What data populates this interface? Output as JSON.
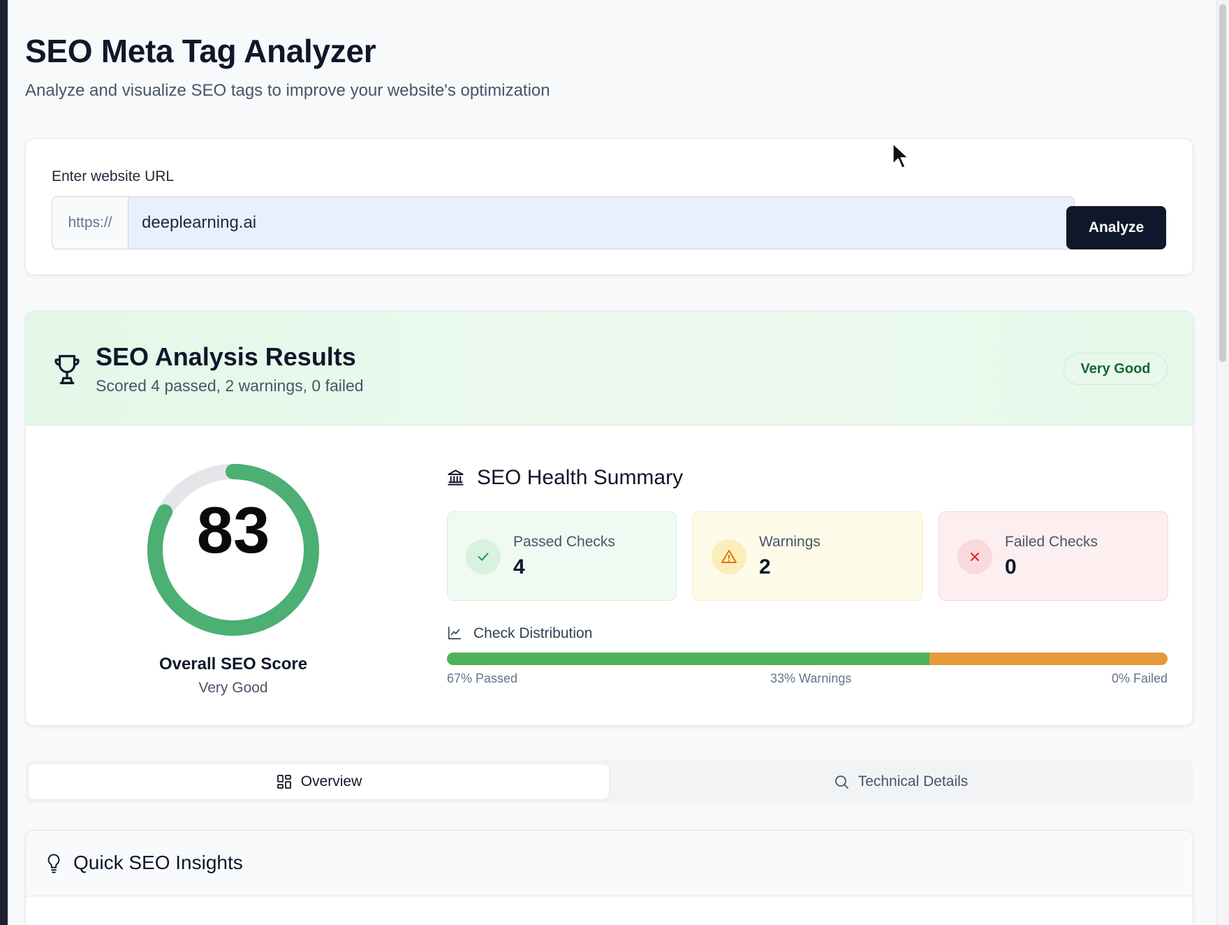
{
  "header": {
    "title": "SEO Meta Tag Analyzer",
    "subtitle": "Analyze and visualize SEO tags to improve your website's optimization"
  },
  "url_form": {
    "label": "Enter website URL",
    "prefix": "https://",
    "value": "deeplearning.ai",
    "button_label": "Analyze"
  },
  "results": {
    "title": "SEO Analysis Results",
    "subtitle": "Scored 4 passed, 2 warnings, 0 failed",
    "badge": "Very Good",
    "score": {
      "value": "83",
      "percent": 83,
      "label": "Overall SEO Score",
      "rating": "Very Good"
    },
    "health_summary": {
      "title": "SEO Health Summary",
      "passed": {
        "label": "Passed Checks",
        "value": "4"
      },
      "warnings": {
        "label": "Warnings",
        "value": "2"
      },
      "failed": {
        "label": "Failed Checks",
        "value": "0"
      }
    },
    "distribution": {
      "title": "Check Distribution",
      "passed_pct": 67,
      "warnings_pct": 33,
      "failed_pct": 0,
      "passed_label": "67% Passed",
      "warnings_label": "33% Warnings",
      "failed_label": "0% Failed"
    }
  },
  "tabs": [
    {
      "label": "Overview",
      "icon": "grid-icon",
      "active": true
    },
    {
      "label": "Technical Details",
      "icon": "search-icon",
      "active": false
    }
  ],
  "insights": {
    "title": "Quick SEO Insights"
  },
  "colors": {
    "passed": "#4fb25a",
    "warning": "#e59a3a",
    "failed": "#dc4a4a",
    "gauge": "#4caf74",
    "primary_button": "#0f172a"
  }
}
